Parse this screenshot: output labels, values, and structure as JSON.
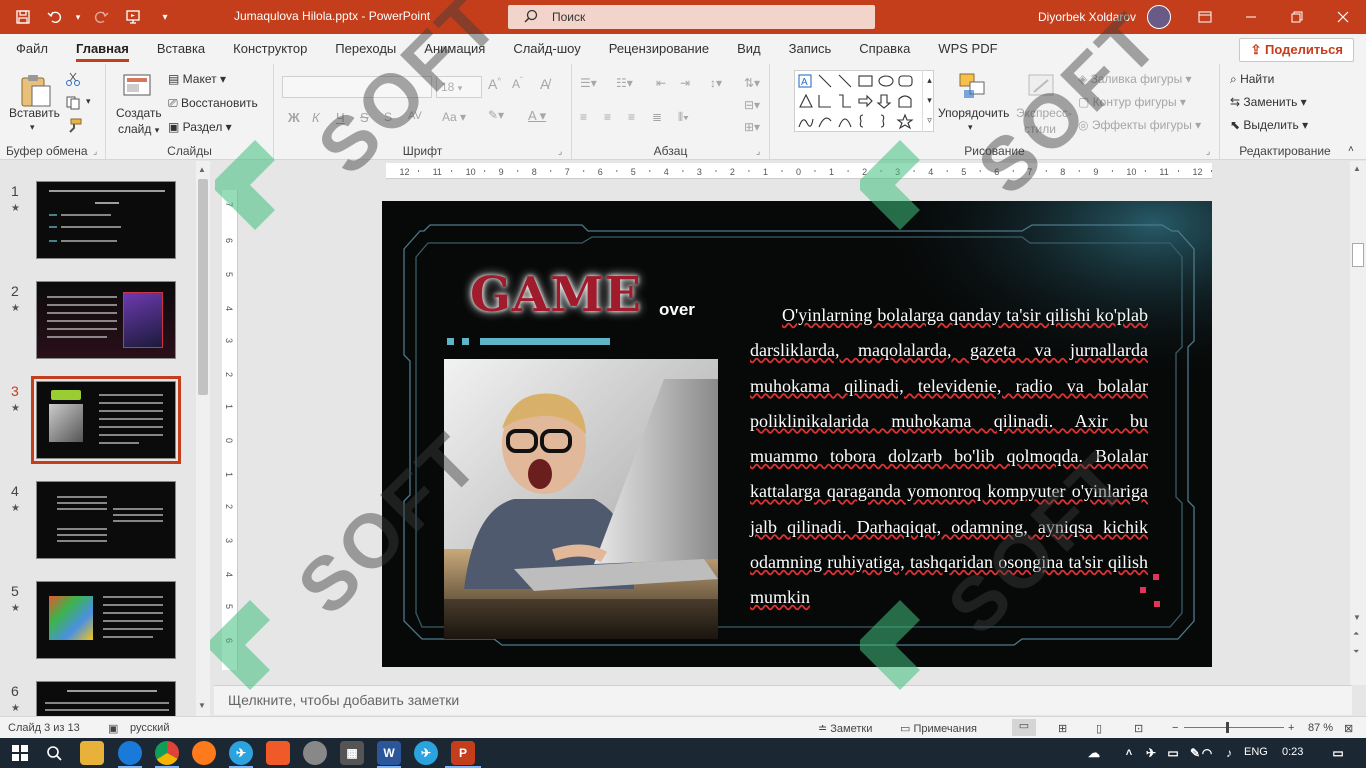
{
  "app": {
    "doc_title": "Jumaqulova Hilola.pptx  -  PowerPoint",
    "search_placeholder": "Поиск",
    "user_name": "Diyorbek Xoldarov",
    "share_label": "Поделиться"
  },
  "tabs": [
    "Файл",
    "Главная",
    "Вставка",
    "Конструктор",
    "Переходы",
    "Анимация",
    "Слайд-шоу",
    "Рецензирование",
    "Вид",
    "Запись",
    "Справка",
    "WPS PDF"
  ],
  "ribbon": {
    "clipboard": {
      "paste": "Вставить",
      "label": "Буфер обмена"
    },
    "slides": {
      "new_slide": "Создать",
      "new_slide2": "слайд",
      "layout": "Макет",
      "reset": "Восстановить",
      "section": "Раздел",
      "label": "Слайды"
    },
    "font": {
      "size": "18",
      "label": "Шрифт",
      "bold": "Ж",
      "italic": "К",
      "underline": "Ч",
      "strike": "S",
      "case": "Aa"
    },
    "paragraph": {
      "label": "Абзац"
    },
    "drawing": {
      "arrange": "Упорядочить",
      "quick_styles": "Экспресс-",
      "quick_styles2": "стили",
      "fill": "Заливка фигуры",
      "outline": "Контур фигуры",
      "effects": "Эффекты фигуры",
      "label": "Рисование"
    },
    "editing": {
      "find": "Найти",
      "replace": "Заменить",
      "select": "Выделить",
      "label": "Редактирование"
    }
  },
  "ruler_marks": [
    "12",
    "11",
    "10",
    "9",
    "8",
    "7",
    "6",
    "5",
    "4",
    "3",
    "2",
    "1",
    "0",
    "1",
    "2",
    "3",
    "4",
    "5",
    "6",
    "7",
    "8",
    "9",
    "10",
    "11",
    "12"
  ],
  "thumbs": [
    {
      "num": "1"
    },
    {
      "num": "2"
    },
    {
      "num": "3"
    },
    {
      "num": "4"
    },
    {
      "num": "5"
    },
    {
      "num": "6"
    }
  ],
  "slide": {
    "title_word": "GAME",
    "title_suffix": "over",
    "body": "O'yinlarning bolalarga qanday ta'sir qilishi ko'plab darsliklarda, maqolalarda, gazeta va jurnallarda muhokama qilinadi, televidenie, radio va bolalar poliklinikalarida muhokama qilinadi. Axir bu muammo tobora dolzarb bo'lib qolmoqda. Bolalar kattalarga qaraganda yomonroq kompyuter o'yinlariga jalb qilinadi. Darhaqiqat, odamning, ayniqsa kichik odamning ruhiyatiga, tashqaridan osongina ta'sir qilish mumkin"
  },
  "notes_placeholder": "Щелкните, чтобы добавить заметки",
  "status": {
    "slide_info": "Слайд 3 из 13",
    "language": "русский",
    "notes": "Заметки",
    "comments": "Примечания",
    "zoom": "87 %"
  },
  "taskbar": {
    "lang": "ENG",
    "time": "0:23"
  },
  "watermark": "SOFT"
}
